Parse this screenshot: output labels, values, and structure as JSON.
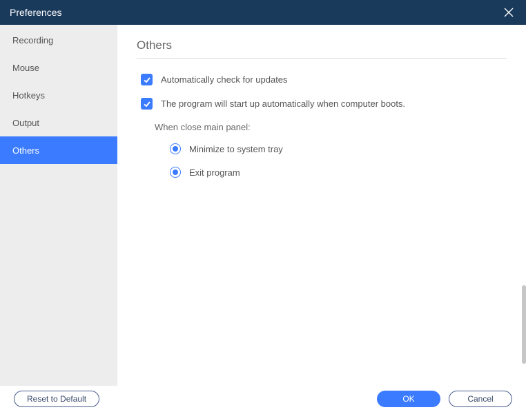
{
  "titlebar": {
    "title": "Preferences"
  },
  "sidebar": {
    "items": [
      {
        "label": "Recording",
        "active": false
      },
      {
        "label": "Mouse",
        "active": false
      },
      {
        "label": "Hotkeys",
        "active": false
      },
      {
        "label": "Output",
        "active": false
      },
      {
        "label": "Others",
        "active": true
      }
    ]
  },
  "main": {
    "section_title": "Others",
    "check_updates_label": "Automatically check for updates",
    "autostart_label": "The program will start up automatically when computer boots.",
    "close_panel_label": "When close main panel:",
    "radio_minimize_label": "Minimize to system tray",
    "radio_exit_label": "Exit program"
  },
  "footer": {
    "reset_label": "Reset to Default",
    "ok_label": "OK",
    "cancel_label": "Cancel"
  }
}
